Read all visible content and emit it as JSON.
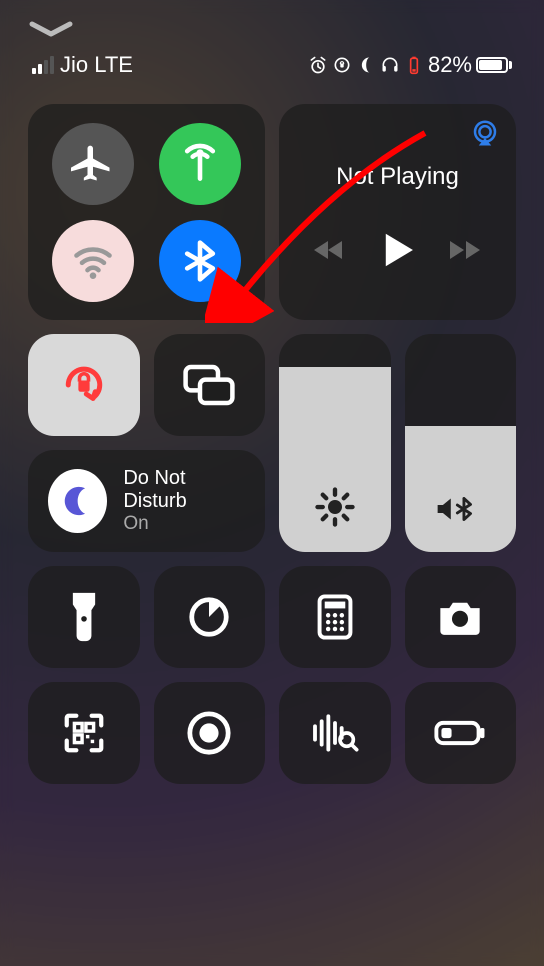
{
  "statusBar": {
    "carrier": "Jio LTE",
    "batteryPercent": "82%"
  },
  "connectivity": {
    "airplane": {
      "active": false
    },
    "cellular": {
      "active": true
    },
    "wifi": {
      "active": false
    },
    "bluetooth": {
      "active": true
    }
  },
  "media": {
    "title": "Not Playing"
  },
  "dnd": {
    "title": "Do Not Disturb",
    "status": "On"
  },
  "brightness": {
    "level": 0.85
  },
  "volume": {
    "level": 0.58
  }
}
